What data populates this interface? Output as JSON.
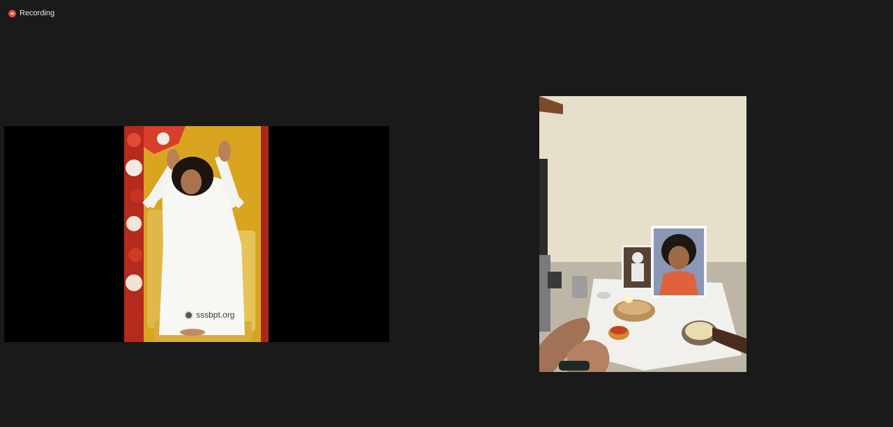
{
  "recording": {
    "label": "Recording",
    "icon": "record-icon",
    "color": "#e0483e"
  },
  "participants": [
    {
      "shared_image": {
        "watermark": "sssbpt.org"
      }
    },
    {
      "video": {}
    }
  ]
}
